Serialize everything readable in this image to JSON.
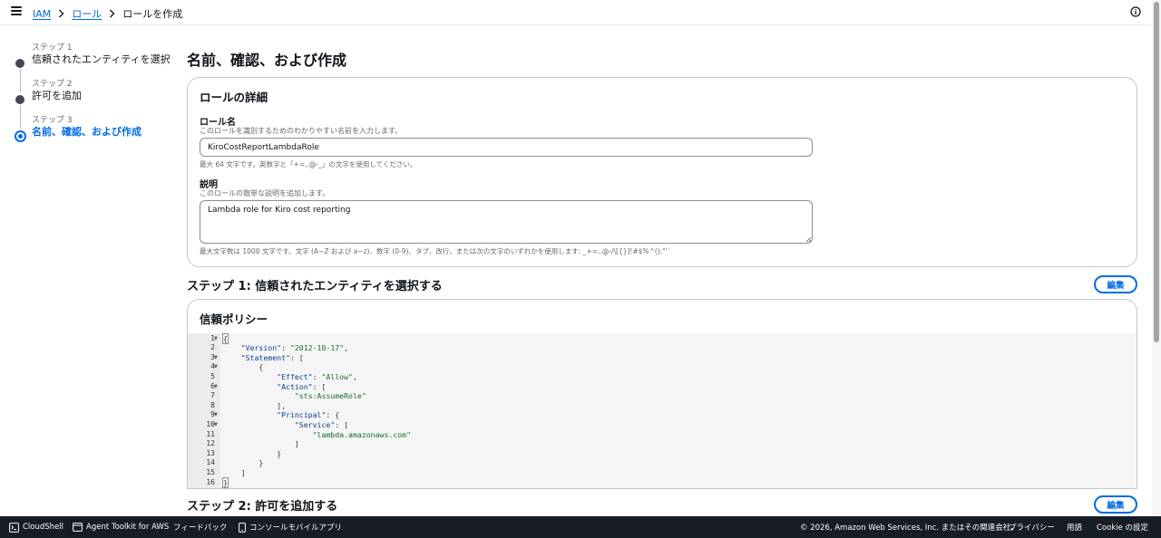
{
  "breadcrumb": {
    "items": [
      "IAM",
      "ロール"
    ],
    "current": "ロールを作成"
  },
  "steps": [
    {
      "title": "ステップ 1",
      "label": "信頼されたエンティティを選択"
    },
    {
      "title": "ステップ 2",
      "label": "許可を追加"
    },
    {
      "title": "ステップ 3",
      "label": "名前、確認、および作成"
    }
  ],
  "page_title": "名前、確認、および作成",
  "role_details": {
    "heading": "ロールの詳細",
    "name_label": "ロール名",
    "name_desc": "このロールを識別するためのわかりやすい名前を入力します。",
    "name_value": "KiroCostReportLambdaRole",
    "name_constraint": "最大 64 文字です。英数字と「+=,.@-_」の文字を使用してください。",
    "desc_label": "説明",
    "desc_desc": "このロールの簡単な説明を追加します。",
    "desc_value": "Lambda role for Kiro cost reporting",
    "desc_constraint": "最大文字数は 1000 文字です。文字 (A~Z および a~z)、数字 (0-9)、タブ、改行、または次の文字のいずれかを使用します: _+=,.@-/\\[{}]!#$%^();\"'`"
  },
  "step1_section": {
    "heading": "ステップ 1: 信頼されたエンティティを選択する",
    "edit_label": "編集"
  },
  "trust_policy": {
    "heading": "信頼ポリシー",
    "lines": [
      "{",
      "    \"Version\": \"2012-10-17\",",
      "    \"Statement\": [",
      "        {",
      "            \"Effect\": \"Allow\",",
      "            \"Action\": [",
      "                \"sts:AssumeRole\"",
      "            ],",
      "            \"Principal\": {",
      "                \"Service\": [",
      "                    \"lambda.amazonaws.com\"",
      "                ]",
      "            }",
      "        }",
      "    ]",
      "}"
    ],
    "line_numbers": [
      "1",
      "2",
      "3",
      "4",
      "5",
      "6",
      "7",
      "8",
      "9",
      "10",
      "11",
      "12",
      "13",
      "14",
      "15",
      "16"
    ],
    "foldable_lines": [
      1,
      3,
      4,
      6,
      9,
      10
    ]
  },
  "step2_section": {
    "heading": "ステップ 2: 許可を追加する",
    "edit_label": "編集"
  },
  "footer": {
    "cloudshell": "CloudShell",
    "agent_toolkit": "Agent Toolkit for AWS",
    "feedback": "フィードバック",
    "mobile_app": "コンソールモバイルアプリ",
    "copyright": "© 2026, Amazon Web Services, Inc. またはその関連会社。",
    "privacy": "プライバシー",
    "terms": "用語",
    "cookie": "Cookie の設定"
  },
  "colors": {
    "link": "#006ce0",
    "footer_bg": "#161d26",
    "border": "#c6c6cd"
  }
}
